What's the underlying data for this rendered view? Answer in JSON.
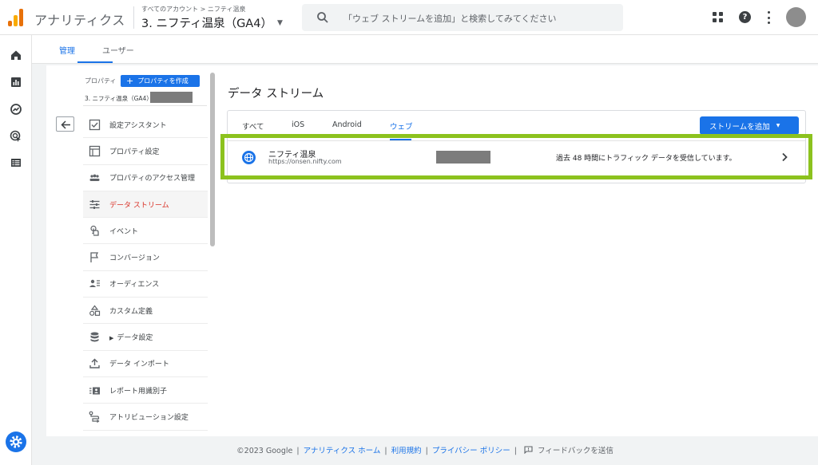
{
  "header": {
    "app_title": "アナリティクス",
    "breadcrumb_root": "すべてのアカウント",
    "breadcrumb_sep": ">",
    "breadcrumb_account": "ニフティ温泉",
    "property_title": "3. ニフティ温泉（GA4）",
    "search_placeholder": "「ウェブ ストリームを追加」と検索してみてください"
  },
  "tabs": [
    {
      "label": "管理",
      "active": true
    },
    {
      "label": "ユーザー",
      "active": false
    }
  ],
  "property_section": {
    "label": "プロパティ",
    "create_button": "プロパティを作成",
    "property_name": "3. ニフティ温泉（GA4）"
  },
  "menu": [
    {
      "label": "設定アシスタント",
      "icon": "checklist-icon"
    },
    {
      "label": "プロパティ設定",
      "icon": "property-settings-icon"
    },
    {
      "label": "プロパティのアクセス管理",
      "icon": "people-icon"
    },
    {
      "label": "データ ストリーム",
      "icon": "data-stream-icon",
      "active": true
    },
    {
      "label": "イベント",
      "icon": "touch-icon"
    },
    {
      "label": "コンバージョン",
      "icon": "flag-icon"
    },
    {
      "label": "オーディエンス",
      "icon": "audience-icon"
    },
    {
      "label": "カスタム定義",
      "icon": "shapes-icon"
    },
    {
      "label": "データ設定",
      "icon": "database-icon",
      "expandable": true
    },
    {
      "label": "データ インポート",
      "icon": "upload-icon"
    },
    {
      "label": "レポート用識別子",
      "icon": "identifier-icon"
    },
    {
      "label": "アトリビューション設定",
      "icon": "attribution-icon"
    }
  ],
  "content": {
    "page_title": "データ ストリーム",
    "filter_tabs": [
      "すべて",
      "iOS",
      "Android",
      "ウェブ"
    ],
    "active_filter": "ウェブ",
    "add_stream_button": "ストリームを追加",
    "stream": {
      "name": "ニフティ温泉",
      "url": "https://onsen.nifty.com",
      "status": "過去 48 時間にトラフィック データを受信しています。"
    }
  },
  "footer": {
    "copyright": "©2023 Google",
    "links": [
      "アナリティクス ホーム",
      "利用規約",
      "プライバシー ポリシー"
    ],
    "feedback": "フィードバックを送信"
  },
  "colors": {
    "accent": "#1a73e8",
    "active_menu_text": "#d93025",
    "highlight_border": "#8cc21e"
  }
}
